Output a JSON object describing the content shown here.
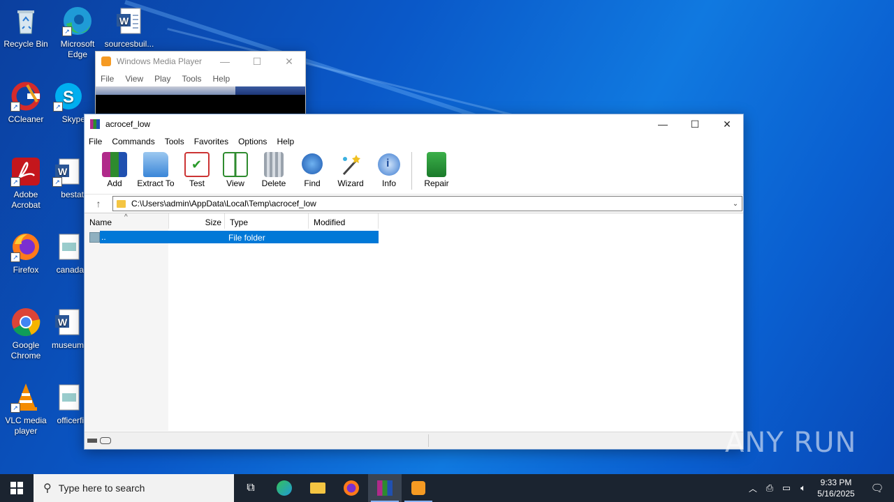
{
  "desktop": {
    "icons": [
      {
        "label": "Recycle Bin"
      },
      {
        "label": "Microsoft Edge"
      },
      {
        "label": "sourcesbuil..."
      },
      {
        "label": "CCleaner"
      },
      {
        "label": "Skype"
      },
      {
        "label": "Adobe Acrobat"
      },
      {
        "label": "bestat"
      },
      {
        "label": "Firefox"
      },
      {
        "label": "canada"
      },
      {
        "label": "Google Chrome"
      },
      {
        "label": "museum"
      },
      {
        "label": "VLC media player"
      },
      {
        "label": "officerfi"
      }
    ]
  },
  "wmp": {
    "title": "Windows Media Player",
    "menu": [
      "File",
      "View",
      "Play",
      "Tools",
      "Help"
    ]
  },
  "winrar": {
    "title": "acrocef_low",
    "menu": [
      "File",
      "Commands",
      "Tools",
      "Favorites",
      "Options",
      "Help"
    ],
    "tools": [
      "Add",
      "Extract To",
      "Test",
      "View",
      "Delete",
      "Find",
      "Wizard",
      "Info",
      "Repair"
    ],
    "path": "C:\\Users\\admin\\AppData\\Local\\Temp\\acrocef_low",
    "columns": [
      "Name",
      "Size",
      "Type",
      "Modified"
    ],
    "rows": [
      {
        "name": "..",
        "size": "",
        "type": "File folder",
        "modified": ""
      }
    ]
  },
  "taskbar": {
    "search_placeholder": "Type here to search",
    "time": "9:33 PM",
    "date": "5/16/2025"
  },
  "watermark": "ANY RUN"
}
